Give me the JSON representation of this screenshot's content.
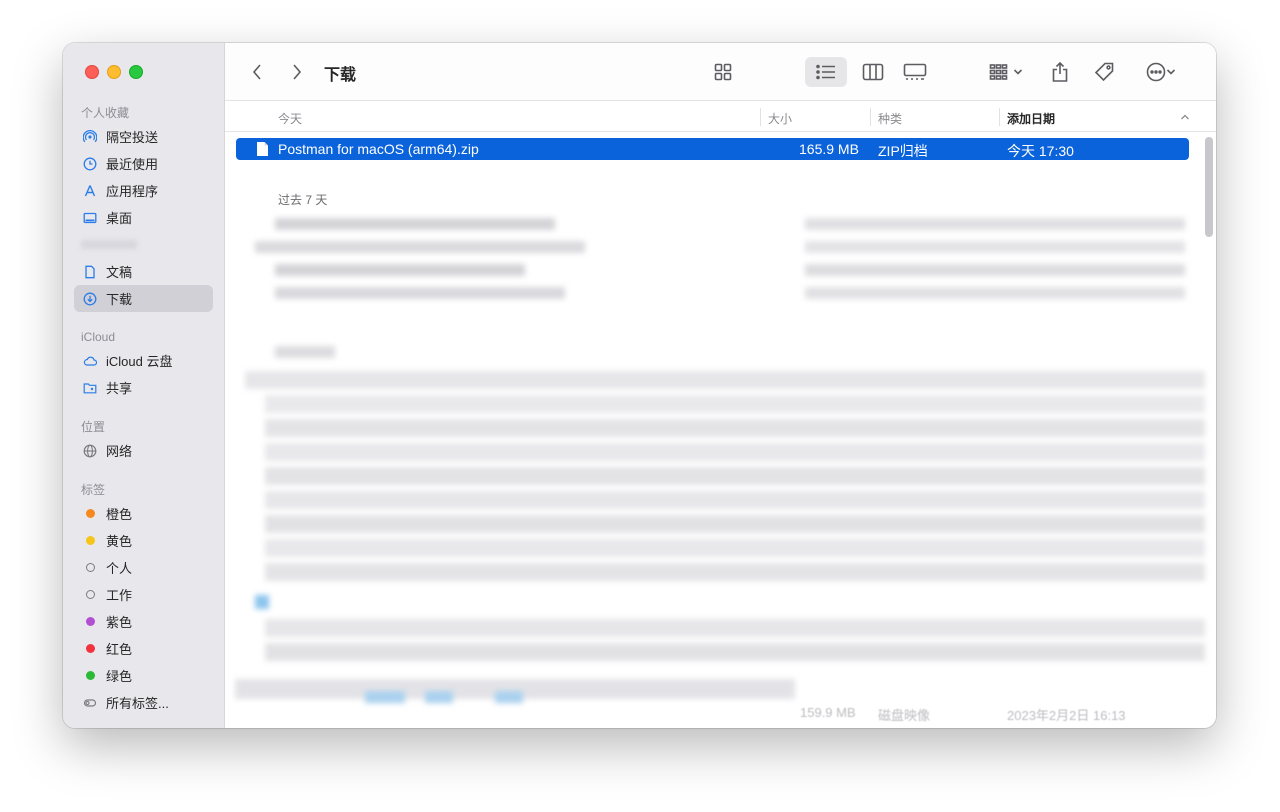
{
  "window": {
    "title": "下载"
  },
  "sidebar": {
    "favorites_title": "个人收藏",
    "favorites": [
      {
        "label": "隔空投送",
        "icon": "airdrop-icon"
      },
      {
        "label": "最近使用",
        "icon": "clock-icon"
      },
      {
        "label": "应用程序",
        "icon": "applications-icon"
      },
      {
        "label": "桌面",
        "icon": "desktop-icon"
      },
      {
        "label": "文稿",
        "icon": "document-icon"
      },
      {
        "label": "下载",
        "icon": "download-icon"
      }
    ],
    "icloud_title": "iCloud",
    "icloud": [
      {
        "label": "iCloud 云盘",
        "icon": "cloud-icon"
      },
      {
        "label": "共享",
        "icon": "shared-folder-icon"
      }
    ],
    "locations_title": "位置",
    "locations": [
      {
        "label": "网络",
        "icon": "globe-icon"
      }
    ],
    "tags_title": "标签",
    "tags": [
      {
        "label": "橙色",
        "color": "#f5891f"
      },
      {
        "label": "黄色",
        "color": "#f5c518"
      },
      {
        "label": "个人",
        "color": ""
      },
      {
        "label": "工作",
        "color": ""
      },
      {
        "label": "紫色",
        "color": "#b24fd3"
      },
      {
        "label": "红色",
        "color": "#f2333d"
      },
      {
        "label": "绿色",
        "color": "#2bba35"
      }
    ],
    "all_tags": "所有标签..."
  },
  "columns": {
    "name": "今天",
    "size": "大小",
    "kind": "种类",
    "date": "添加日期"
  },
  "files_today": [
    {
      "name": "Postman for macOS (arm64).zip",
      "size": "165.9 MB",
      "kind": "ZIP归档",
      "date": "今天 17:30",
      "selected": true
    }
  ],
  "group_past7": "过去 7 天",
  "ghost_row": {
    "size": "159.9 MB",
    "kind": "磁盘映像",
    "date": "2023年2月2日 16:13"
  },
  "colors": {
    "selection": "#0a63db",
    "sidebar_bg": "#e8e7ec"
  }
}
